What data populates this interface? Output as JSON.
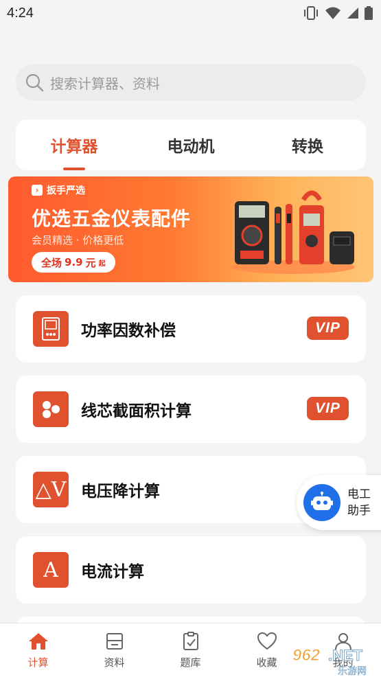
{
  "status_bar": {
    "time": "4:24"
  },
  "search": {
    "placeholder": "搜索计算器、资料"
  },
  "tabs": [
    {
      "label": "计算器",
      "active": true
    },
    {
      "label": "电动机",
      "active": false
    },
    {
      "label": "转换",
      "active": false
    }
  ],
  "banner": {
    "brand": "扳手严选",
    "headline": "优选五金仪表配件",
    "subtitle": "会员精选 · 价格更低",
    "price_prefix": "全场",
    "price": "9.9",
    "price_unit": "元",
    "price_suffix": "起"
  },
  "calculators": [
    {
      "label": "功率因数补偿",
      "icon": "device-icon",
      "vip": "VIP"
    },
    {
      "label": "线芯截面积计算",
      "icon": "cores-icon",
      "vip": "VIP"
    },
    {
      "label": "电压降计算",
      "icon_text": "△V"
    },
    {
      "label": "电流计算",
      "icon_text": "A"
    }
  ],
  "assistant": {
    "line1": "电工",
    "line2": "助手"
  },
  "bottom_nav": [
    {
      "label": "计算",
      "icon": "home-icon",
      "active": true
    },
    {
      "label": "资料",
      "icon": "box-icon",
      "active": false
    },
    {
      "label": "题库",
      "icon": "checklist-icon",
      "active": false
    },
    {
      "label": "收藏",
      "icon": "heart-icon",
      "active": false
    },
    {
      "label": "我的",
      "icon": "user-icon",
      "active": false
    }
  ],
  "watermark": {
    "text": "962.NET",
    "sub": "乐游网"
  },
  "colors": {
    "accent": "#e0522f",
    "assistant": "#1f6fe8"
  }
}
